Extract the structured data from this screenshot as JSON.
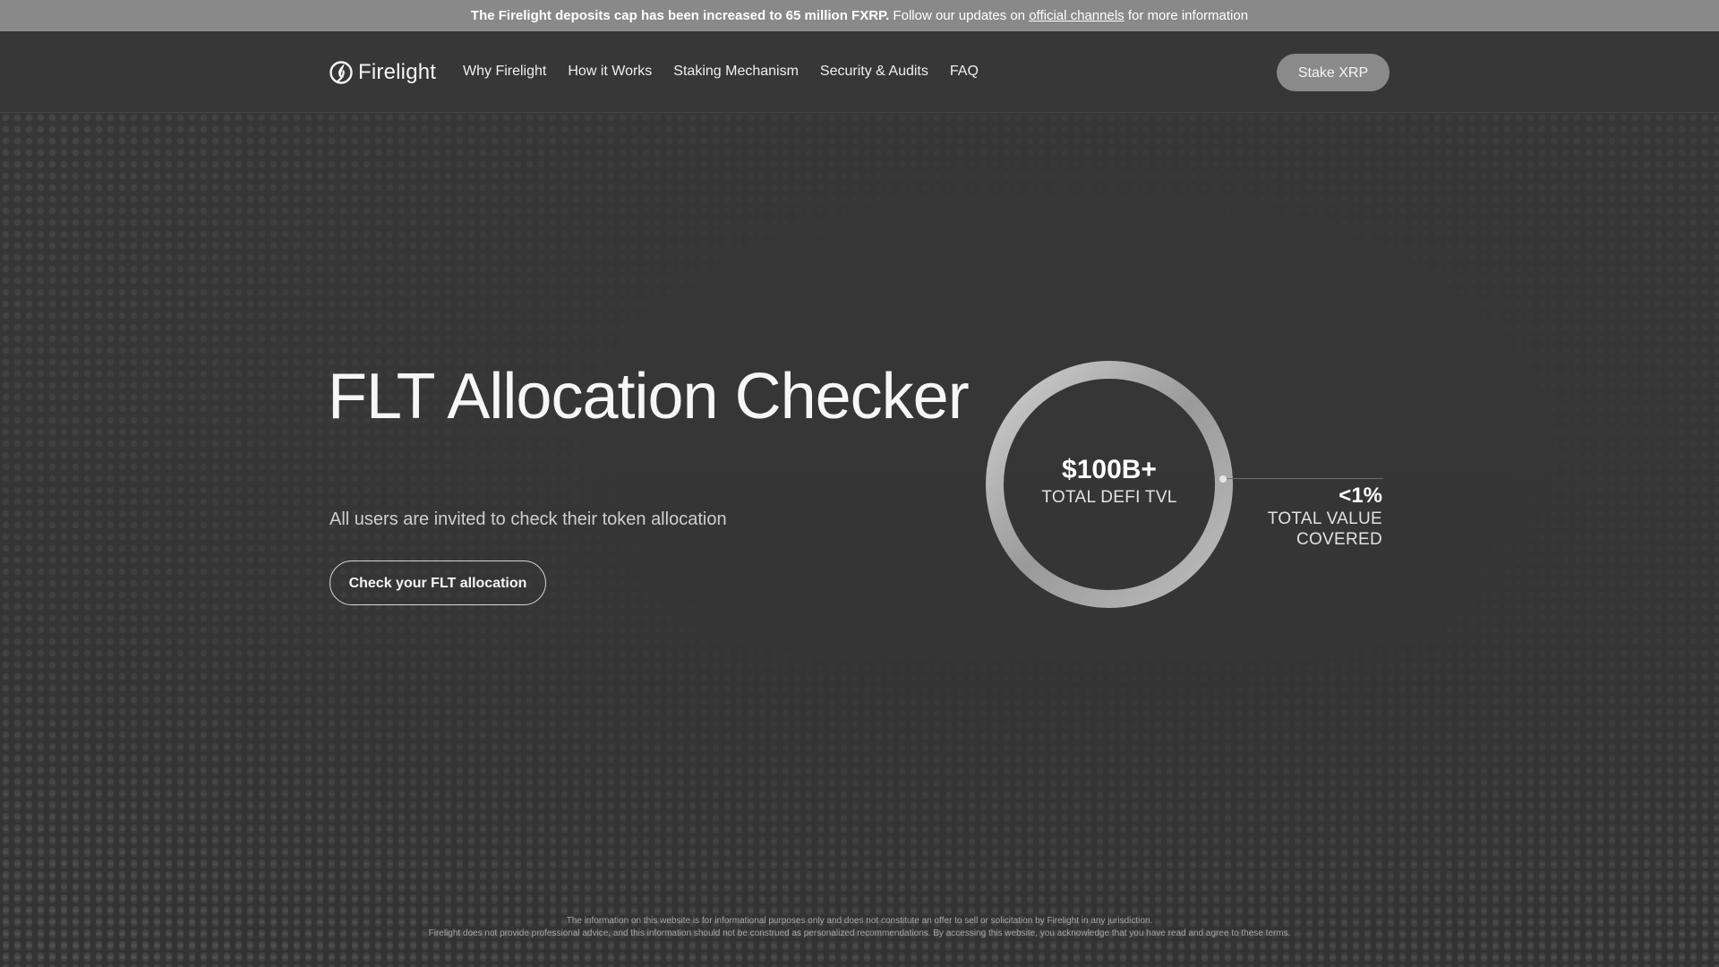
{
  "announcement": {
    "bold_text": "The Firelight deposits cap has been increased to 65 million FXRP.",
    "text_before_link": " Follow our updates on ",
    "link_label": "official channels",
    "text_after_link": " for more information"
  },
  "header": {
    "logo_text": "Firelight",
    "nav": [
      "Why Firelight",
      "How it Works",
      "Staking Mechanism",
      "Security & Audits",
      "FAQ"
    ],
    "cta_label": "Stake XRP"
  },
  "hero": {
    "title": "FLT Allocation Checker",
    "subtitle": "All users are invited to check their token allocation",
    "button_label": "Check your FLT allocation"
  },
  "stats": {
    "ring_value": "$100B+",
    "ring_label": "TOTAL DEFI TVL",
    "side_value": "<1%",
    "side_label_line1": "TOTAL VALUE",
    "side_label_line2": "COVERED"
  },
  "footer": {
    "disclaimer_line1": "The information on this website is for informational purposes only and does not constitute an offer to sell or solicitation by Firelight in any jurisdiction.",
    "disclaimer_line2": "Firelight does not provide professional advice, and this information should not be construed as personalized recommendations. By accessing this website, you acknowledge that you have read and agree to these terms."
  },
  "icons": {
    "logo": "flame-logo-icon"
  },
  "colors": {
    "background": "#363636",
    "announcement_bar": "#898989",
    "button_gray": "#8a8a8a",
    "text_primary": "#f6f6f6"
  }
}
